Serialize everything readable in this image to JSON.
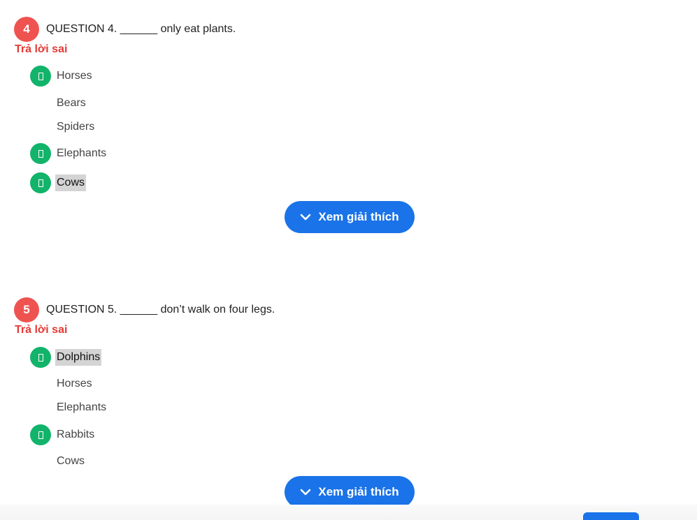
{
  "questions": [
    {
      "number": "4",
      "text": "QUESTION 4. ______ only eat plants.",
      "status": "Trả lời sai",
      "options": [
        {
          "label": "Horses",
          "marked": true,
          "selected": false
        },
        {
          "label": "Bears",
          "marked": false,
          "selected": false
        },
        {
          "label": "Spiders",
          "marked": false,
          "selected": false
        },
        {
          "label": "Elephants",
          "marked": true,
          "selected": false
        },
        {
          "label": "Cows",
          "marked": true,
          "selected": true
        }
      ],
      "explain_label": "Xem giải thích"
    },
    {
      "number": "5",
      "text": "QUESTION 5. ______ don’t walk on four legs.",
      "status": "Trả lời sai",
      "options": [
        {
          "label": "Dolphins",
          "marked": true,
          "selected": true
        },
        {
          "label": "Horses",
          "marked": false,
          "selected": false
        },
        {
          "label": "Elephants",
          "marked": false,
          "selected": false
        },
        {
          "label": "Rabbits",
          "marked": true,
          "selected": false
        },
        {
          "label": "Cows",
          "marked": false,
          "selected": false
        }
      ],
      "explain_label": "Xem giải thích"
    }
  ],
  "colors": {
    "number_badge": "#ef5350",
    "wrong_status": "#e53935",
    "option_marker": "#12b36a",
    "explain_button": "#1a73e8",
    "selected_highlight": "#d4d4d4"
  },
  "icons": {
    "option_marker": "missing-glyph-icon",
    "explain_button": "chevron-down-icon"
  }
}
